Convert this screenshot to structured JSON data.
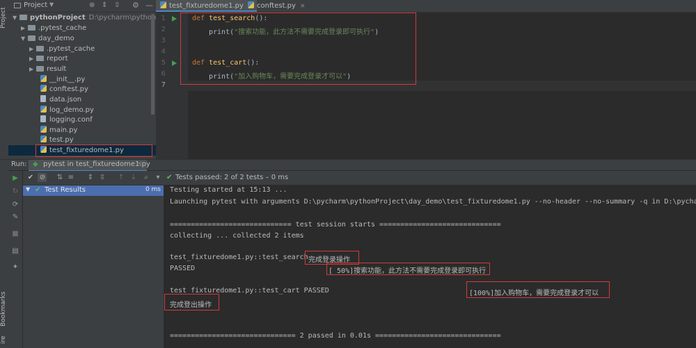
{
  "side_labels": {
    "project": "Project",
    "bookmarks": "Bookmarks",
    "structure": "ire"
  },
  "project_header": {
    "title": "Project"
  },
  "tree": {
    "root": {
      "name": "pythonProject",
      "path": "D:\\pycharm\\pythonProject"
    },
    "items": [
      {
        "label": ".pytest_cache"
      },
      {
        "label": "day_demo"
      },
      {
        "label": ".pytest_cache"
      },
      {
        "label": "report"
      },
      {
        "label": "result"
      },
      {
        "label": "__init__.py"
      },
      {
        "label": "conftest.py"
      },
      {
        "label": "data.json"
      },
      {
        "label": "log_demo.py"
      },
      {
        "label": "logging.conf"
      },
      {
        "label": "main.py"
      },
      {
        "label": "test.py"
      },
      {
        "label": "test_fixturedome1.py"
      }
    ]
  },
  "editor": {
    "tabs": [
      {
        "label": "test_fixturedome1.py",
        "close": "×"
      },
      {
        "label": "conftest.py",
        "close": "×"
      }
    ],
    "line_numbers": [
      "1",
      "2",
      "3",
      "4",
      "5",
      "6",
      "7"
    ],
    "code": {
      "l1_kw": "def ",
      "l1_fn": "test_search",
      "l1_rest": "():",
      "l2_fn": "print",
      "l2_open": "(",
      "l2_str": "\"搜索功能，此方法不需要完成登录即可执行\"",
      "l2_close": ")",
      "l5_kw": "def ",
      "l5_fn": "test_cart",
      "l5_rest": "():",
      "l6_fn": "print",
      "l6_open": "(",
      "l6_str": "\"加入购物车，需要完成登录才可以\"",
      "l6_close": ")"
    }
  },
  "run": {
    "label": "Run:",
    "tab": "pytest in test_fixturedome1.py",
    "tab_close": "×",
    "status": "Tests passed: 2 of 2 tests – 0 ms",
    "test_results": {
      "label": "Test Results",
      "time": "0 ms"
    }
  },
  "console": {
    "lines": [
      "Testing started at 15:13 ...",
      "Launching pytest with arguments D:\\pycharm\\pythonProject\\day_demo\\test_fixturedome1.py --no-header --no-summary -q in D:\\pycharm\\",
      "============================= test session starts =============================",
      "collecting ... collected 2 items",
      "test_fixturedome1.py::test_search",
      "完成登录操作",
      "PASSED",
      "[ 50%]搜索功能，此方法不需要完成登录即可执行",
      "test_fixturedome1.py::test_cart PASSED",
      "[100%]加入购物车，需要完成登录才可以",
      "完成登出操作",
      "============================== 2 passed in 0.01s =============================="
    ]
  },
  "colors": {
    "accent": "#4a88c7",
    "pass": "#499c54",
    "highlight": "#d23b3b"
  }
}
